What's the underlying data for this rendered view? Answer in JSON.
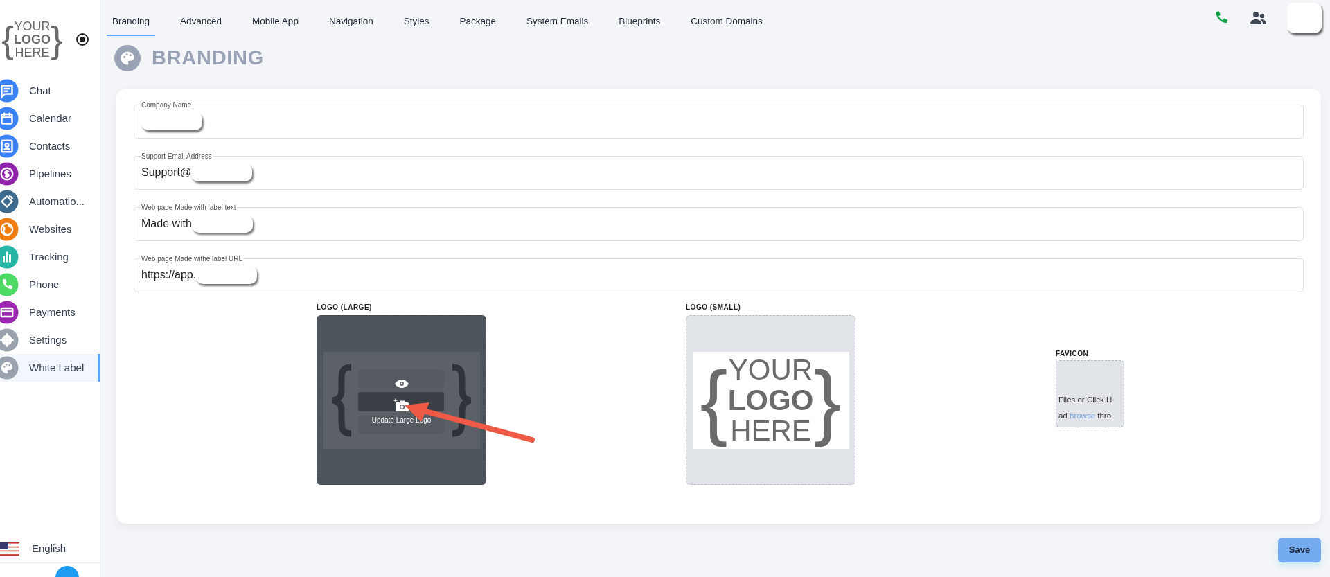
{
  "sidebar": {
    "logo": {
      "open": "{",
      "lines": [
        "YOUR",
        "LOGO",
        "HERE"
      ],
      "close": "}"
    },
    "items": [
      {
        "label": "Chat",
        "color": "#3b82f6",
        "selected": false
      },
      {
        "label": "Calendar",
        "color": "#3b82f6",
        "selected": false
      },
      {
        "label": "Contacts",
        "color": "#3b82f6",
        "selected": false
      },
      {
        "label": "Pipelines",
        "color": "#8e24aa",
        "selected": false
      },
      {
        "label": "Automatio...",
        "color": "#3e6b8e",
        "selected": false
      },
      {
        "label": "Websites",
        "color": "#ef7d10",
        "selected": false
      },
      {
        "label": "Tracking",
        "color": "#26b5a5",
        "selected": false
      },
      {
        "label": "Phone",
        "color": "#4cd964",
        "selected": false
      },
      {
        "label": "Payments",
        "color": "#9c27b0",
        "selected": false
      },
      {
        "label": "Settings",
        "color": "#9aa3ad",
        "selected": false
      },
      {
        "label": "White Label",
        "color": "#9aa3ad",
        "selected": true
      }
    ],
    "language": "English"
  },
  "tabs": [
    {
      "label": "Branding",
      "selected": true
    },
    {
      "label": "Advanced",
      "selected": false
    },
    {
      "label": "Mobile App",
      "selected": false
    },
    {
      "label": "Navigation",
      "selected": false
    },
    {
      "label": "Styles",
      "selected": false
    },
    {
      "label": "Package",
      "selected": false
    },
    {
      "label": "System Emails",
      "selected": false
    },
    {
      "label": "Blueprints",
      "selected": false
    },
    {
      "label": "Custom Domains",
      "selected": false
    }
  ],
  "page_title": "BRANDING",
  "fields": [
    {
      "label": "Company Name",
      "redacted": true
    },
    {
      "label": "Support Email Address",
      "value": "Support@",
      "redacted": true
    },
    {
      "label": "Web page Made with label text",
      "value": "Made with",
      "redacted": true
    },
    {
      "label": "Web page Made withe label URL",
      "value": "https://app.",
      "redacted": true
    }
  ],
  "logos": [
    {
      "label": "LOGO (LARGE)",
      "kind": "hover",
      "overlay_text": "Update Large Logo"
    },
    {
      "label": "LOGO (SMALL)",
      "kind": "plain",
      "logo": {
        "open": "{",
        "lines": [
          "YOUR",
          "LOGO",
          "HERE"
        ],
        "close": "}"
      }
    }
  ],
  "favicon": {
    "label": "FAVICON",
    "line_1": "Files or Click H",
    "line_2_before": "ad",
    "link": "browse",
    "line_2_after": "thro"
  },
  "save_button": "Save"
}
